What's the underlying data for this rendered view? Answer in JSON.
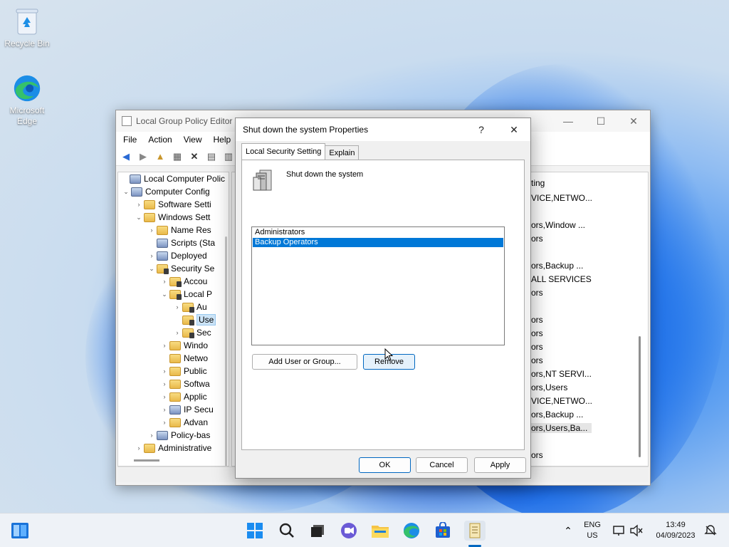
{
  "desktop": {
    "icons": [
      {
        "label": "Recycle Bin"
      },
      {
        "label": "Microsoft Edge"
      }
    ]
  },
  "gpe": {
    "title": "Local Group Policy Editor",
    "menu": [
      "File",
      "Action",
      "View",
      "Help"
    ],
    "tree": [
      {
        "label": "Local Computer Polic"
      },
      {
        "label": "Computer Config"
      },
      {
        "label": "Software Setti"
      },
      {
        "label": "Windows Sett"
      },
      {
        "label": "Name Res"
      },
      {
        "label": "Scripts (Sta"
      },
      {
        "label": "Deployed"
      },
      {
        "label": "Security Se"
      },
      {
        "label": "Accou"
      },
      {
        "label": "Local P"
      },
      {
        "label": "Au"
      },
      {
        "label": "Use"
      },
      {
        "label": "Sec"
      },
      {
        "label": "Windo"
      },
      {
        "label": "Netwo"
      },
      {
        "label": "Public"
      },
      {
        "label": "Softwa"
      },
      {
        "label": "Applic"
      },
      {
        "label": "IP Secu"
      },
      {
        "label": "Advan"
      },
      {
        "label": "Policy-bas"
      },
      {
        "label": "Administrative"
      }
    ],
    "list_fragments": [
      "ting",
      "VICE,NETWO...",
      "ors,Window ...",
      "ors",
      "ors,Backup ...",
      "ALL SERVICES",
      "ors",
      "ors",
      "ors",
      "ors",
      "ors",
      "ors,NT SERVI...",
      "ors,Users",
      "VICE,NETWO...",
      "ors,Backup ...",
      "ors,Users,Ba...",
      "ors"
    ]
  },
  "dialog": {
    "title": "Shut down the system Properties",
    "help_glyph": "?",
    "close_glyph": "✕",
    "tabs": [
      {
        "label": "Local Security Setting"
      },
      {
        "label": "Explain"
      }
    ],
    "policy_name": "Shut down the system",
    "members": [
      {
        "label": "Administrators"
      },
      {
        "label": "Backup Operators"
      }
    ],
    "add_button": "Add User or Group...",
    "remove_button": "Remove",
    "ok_button": "OK",
    "cancel_button": "Cancel",
    "apply_button": "Apply"
  },
  "taskbar": {
    "lang_line1": "ENG",
    "lang_line2": "US",
    "time": "13:49",
    "date": "04/09/2023"
  }
}
